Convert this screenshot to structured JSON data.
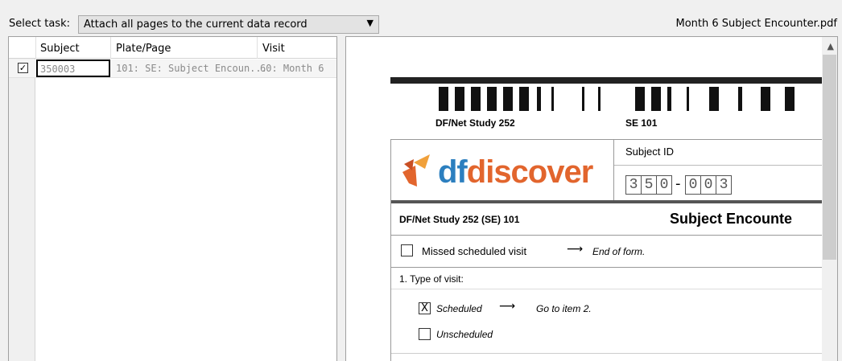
{
  "toolbar": {
    "task_label": "Select task:",
    "task_value": "Attach all pages to the current data record",
    "file_name": "Month 6 Subject Encounter.pdf"
  },
  "table": {
    "columns": [
      "Subject",
      "Plate/Page",
      "Visit"
    ],
    "rows": [
      {
        "checked": true,
        "subject": "350003",
        "plate_page": "101: SE: Subject Encoun...",
        "visit": "60: Month 6"
      }
    ]
  },
  "preview": {
    "barcode_left_label": "DF/Net Study 252",
    "barcode_right_label": "SE 101",
    "logo_prefix": "df",
    "logo_suffix": "discover",
    "subject_id_label": "Subject ID",
    "subject_id_digits": [
      "3",
      "5",
      "0",
      "0",
      "0",
      "3"
    ],
    "form_code": "DF/Net Study 252 (SE) 101",
    "form_title": "Subject Encounte",
    "missed_label": "Missed scheduled visit",
    "missed_goto": "End of form.",
    "q1_label": "1. Type of visit:",
    "option_scheduled": "Scheduled",
    "option_scheduled_goto": "Go to item 2.",
    "option_unscheduled": "Unscheduled",
    "scheduled_mark": "X",
    "arrow_glyph": "⟶"
  },
  "colors": {
    "logo_orange": "#e2652d",
    "logo_blue": "#2c7fbf"
  }
}
